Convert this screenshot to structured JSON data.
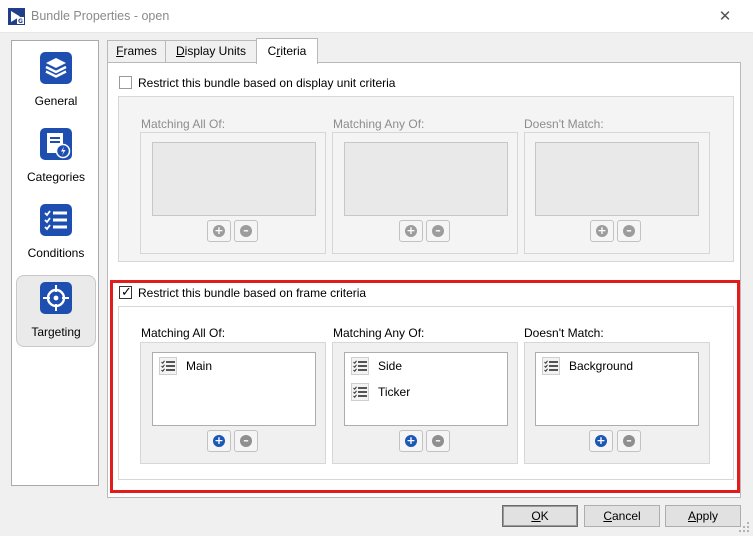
{
  "window": {
    "title": "Bundle Properties - open",
    "close_glyph": "✕"
  },
  "sidebar": {
    "items": [
      {
        "label": "General",
        "icon": "stack-layers-icon",
        "active": false
      },
      {
        "label": "Categories",
        "icon": "category-file-icon",
        "active": false
      },
      {
        "label": "Conditions",
        "icon": "checklist-icon",
        "active": false
      },
      {
        "label": "Targeting",
        "icon": "crosshair-target-icon",
        "active": true
      }
    ]
  },
  "tabs": [
    {
      "label": "Frames",
      "accel": "F",
      "rest": "rames",
      "active": false
    },
    {
      "label": "Display Units",
      "accel": "D",
      "rest": "isplay Units",
      "active": false
    },
    {
      "label": "Criteria",
      "pre": "C",
      "accel": "r",
      "rest": "iteria",
      "active": true
    }
  ],
  "display_unit_section": {
    "checkbox_label": "Restrict this bundle based on display unit criteria",
    "checked": false,
    "enabled": false,
    "columns": [
      {
        "label": "Matching All Of:",
        "items": []
      },
      {
        "label": "Matching Any Of:",
        "items": []
      },
      {
        "label": "Doesn't Match:",
        "items": []
      }
    ]
  },
  "frame_section": {
    "checkbox_label": "Restrict this bundle based on frame criteria",
    "checked": true,
    "enabled": true,
    "columns": [
      {
        "label": "Matching All Of:",
        "items": [
          "Main"
        ]
      },
      {
        "label": "Matching Any Of:",
        "items": [
          "Side",
          "Ticker"
        ]
      },
      {
        "label": "Doesn't Match:",
        "items": [
          "Background"
        ]
      }
    ]
  },
  "buttons": {
    "ok": {
      "label": "OK",
      "accel": "O",
      "rest": "K"
    },
    "cancel": {
      "label": "Cancel",
      "accel": "C",
      "rest": "ancel"
    },
    "apply": {
      "label": "Apply",
      "accel": "A",
      "rest": "pply"
    }
  },
  "colors": {
    "accent_blue": "#1b57b5",
    "highlight_red": "#e21b1b"
  }
}
